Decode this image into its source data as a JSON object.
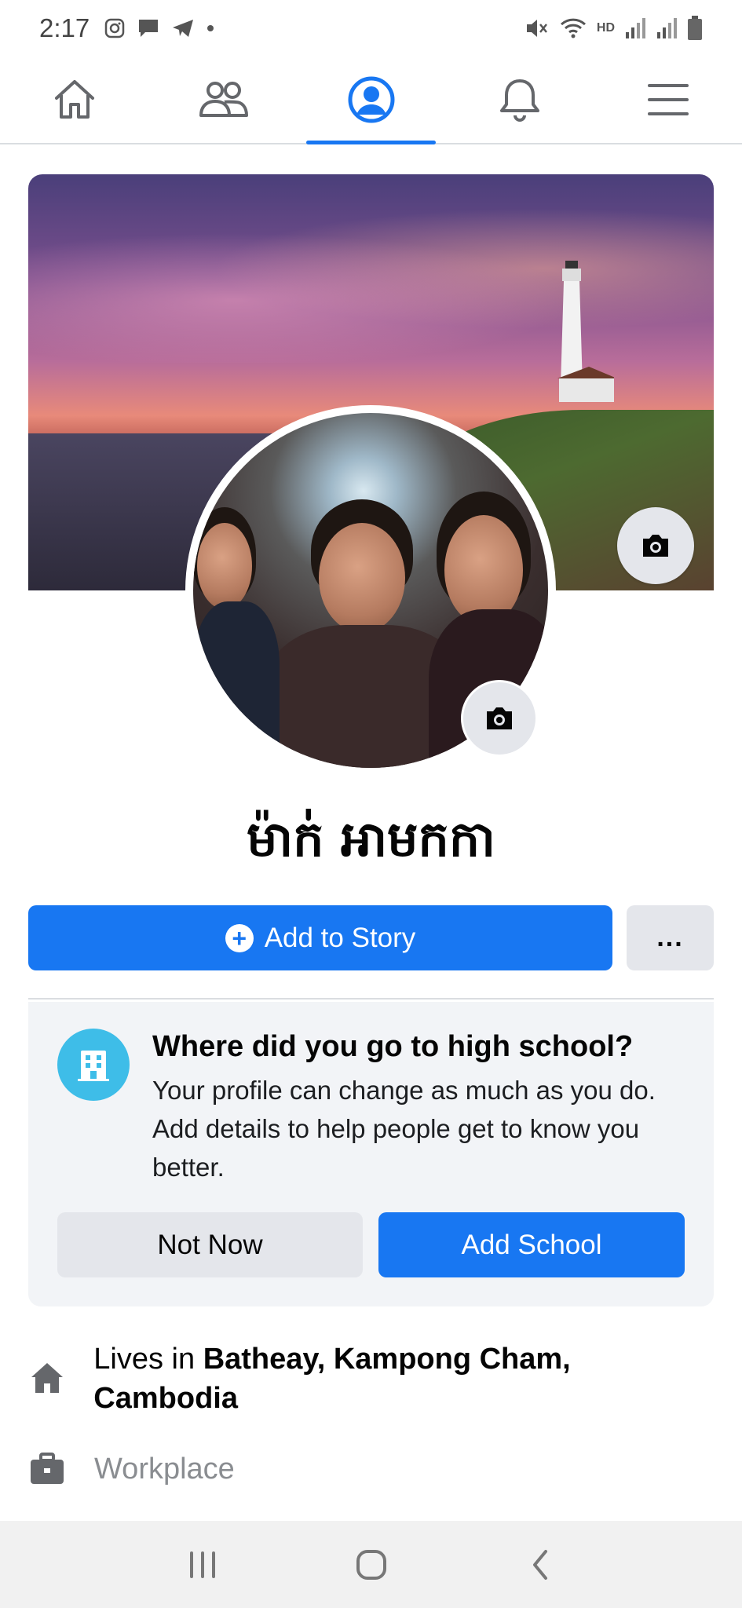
{
  "status_bar": {
    "time": "2:17",
    "left_icons": [
      "instagram-icon",
      "message-icon",
      "telegram-icon",
      "dot-icon"
    ],
    "network_label": "HD",
    "right_icons": [
      "mute-icon",
      "wifi-icon",
      "signal-icon",
      "signal-icon",
      "battery-icon"
    ]
  },
  "nav": {
    "tabs": [
      {
        "name": "home",
        "icon": "home-icon",
        "active": false
      },
      {
        "name": "friends",
        "icon": "friends-icon",
        "active": false
      },
      {
        "name": "profile",
        "icon": "profile-icon",
        "active": true
      },
      {
        "name": "notifications",
        "icon": "bell-icon",
        "active": false
      },
      {
        "name": "menu",
        "icon": "menu-icon",
        "active": false
      }
    ],
    "accent": "#1877f2"
  },
  "profile": {
    "name": "ម៉ាក់ អាមកកា",
    "cover_camera_icon": "camera-icon",
    "avatar_camera_icon": "camera-icon"
  },
  "actions": {
    "add_story_label": "Add to Story",
    "more_label": "..."
  },
  "prompt": {
    "icon": "school-icon",
    "title": "Where did you go to high school?",
    "body": "Your profile can change as much as you do. Add details to help people get to know you better.",
    "not_now_label": "Not Now",
    "add_school_label": "Add School"
  },
  "details": {
    "lives_prefix": "Lives in ",
    "lives_location": "Batheay, Kampong Cham, Cambodia",
    "workplace_label": "Workplace"
  },
  "android_nav": [
    "recents-icon",
    "home-circle-icon",
    "back-icon"
  ]
}
